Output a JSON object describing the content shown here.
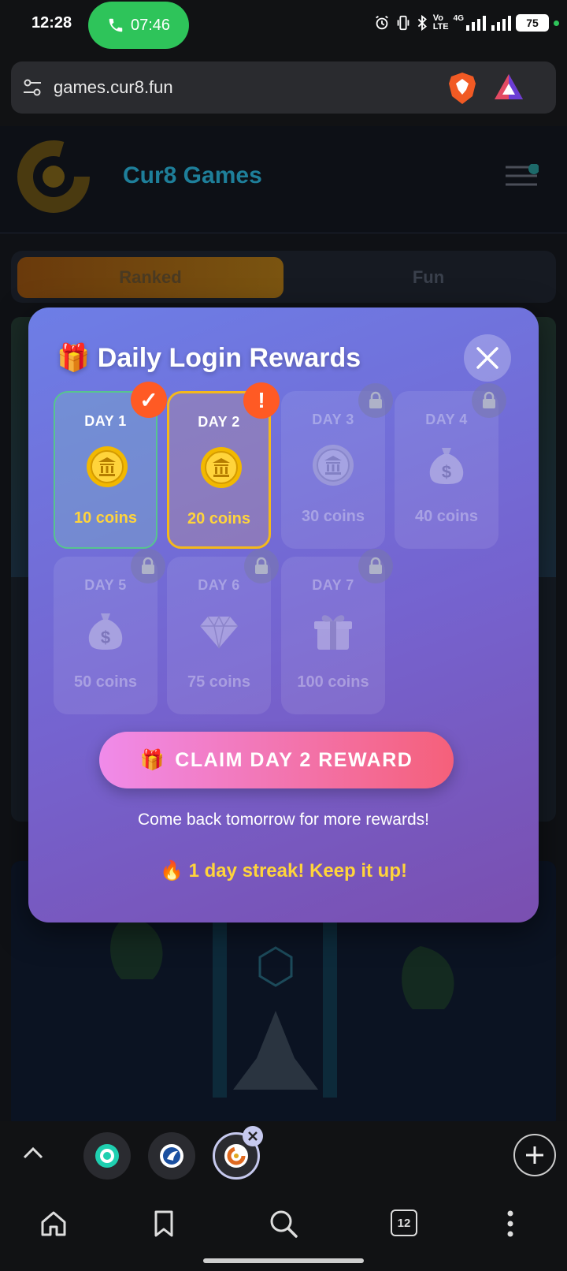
{
  "status_bar": {
    "time": "12:28",
    "call_timer": "07:46",
    "network_label_1": "Vo",
    "network_label_2": "LTE",
    "network_type": "4G",
    "battery": "75"
  },
  "browser": {
    "url": "games.cur8.fun",
    "tab_count": "12"
  },
  "site": {
    "title": "Cur8 Games",
    "tabs": [
      {
        "label": "Ranked"
      },
      {
        "label": "Fun"
      }
    ]
  },
  "modal": {
    "title_icon": "🎁",
    "title": "Daily Login Rewards",
    "days": [
      {
        "label": "DAY 1",
        "reward": "10 coins",
        "icon": "🪙",
        "state": "claimed"
      },
      {
        "label": "DAY 2",
        "reward": "20 coins",
        "icon": "🪙",
        "state": "available"
      },
      {
        "label": "DAY 3",
        "reward": "30 coins",
        "icon": "🪙",
        "state": "locked"
      },
      {
        "label": "DAY 4",
        "reward": "40 coins",
        "icon": "💰",
        "state": "locked"
      },
      {
        "label": "DAY 5",
        "reward": "50 coins",
        "icon": "💰",
        "state": "locked"
      },
      {
        "label": "DAY 6",
        "reward": "75 coins",
        "icon": "💎",
        "state": "locked"
      },
      {
        "label": "DAY 7",
        "reward": "100 coins",
        "icon": "🎁",
        "state": "locked"
      }
    ],
    "claim_button_icon": "🎁",
    "claim_button": "CLAIM DAY 2 REWARD",
    "message": "Come back tomorrow for more rewards!",
    "streak_icon": "🔥",
    "streak": "1 day streak! Keep it up!"
  },
  "colors": {
    "call_green": "#2ec45a",
    "claimed_border": "#57c48f",
    "current_border": "#f4b81c",
    "coins_text": "#ffd43b",
    "badge_orange": "#ff5a24"
  }
}
